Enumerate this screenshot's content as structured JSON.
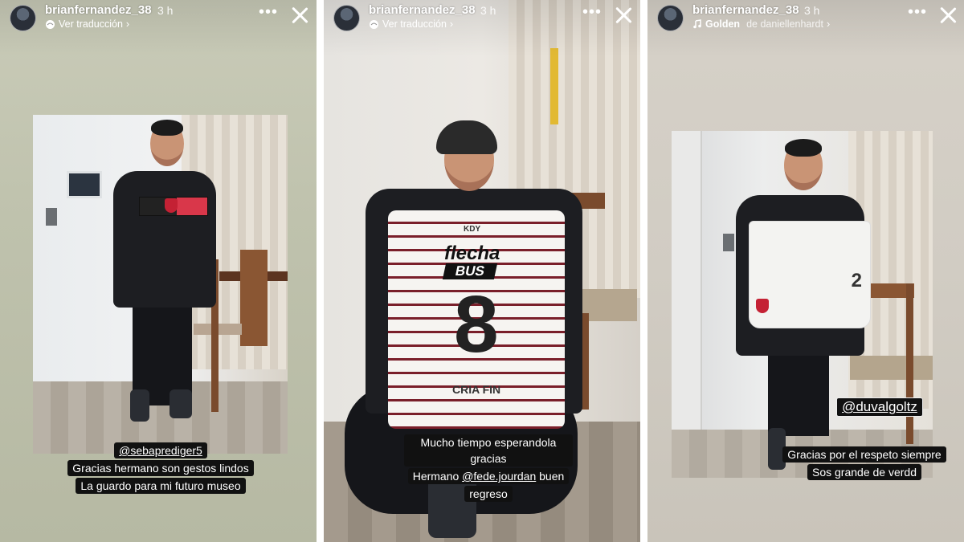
{
  "stories": [
    {
      "username": "brianfernandez_38",
      "time": "3 h",
      "subline": "Ver traducción",
      "more_label": "•••",
      "captions": {
        "mention": "@sebaprediger5",
        "line1": "Gracias hermano son gestos lindos",
        "line2": "La guardo para mi futuro museo"
      }
    },
    {
      "username": "brianfernandez_38",
      "time": "3 h",
      "subline": "Ver traducción",
      "more_label": "•••",
      "captions": {
        "line1": "Mucho tiempo esperandola gracias",
        "line2_prefix": "Hermano",
        "line2_mention": "@fede.jourdan",
        "line2_suffix": "buen",
        "line3": "regreso"
      },
      "jersey": {
        "sponsor_top": "flecha",
        "sponsor_bottom": "BUS",
        "number": "8",
        "brand": "KDY",
        "lower_sponsor": "CRIA",
        "lower_sponsor2": "FIN"
      }
    },
    {
      "username": "brianfernandez_38",
      "time": "3 h",
      "music_title": "Golden",
      "music_artist": "de daniellenhardt",
      "more_label": "•••",
      "captions": {
        "mention": "@duvalgoltz",
        "line1": "Gracias por el respeto siempre",
        "line2": "Sos grande de verdd"
      },
      "shorts_number": "2"
    }
  ],
  "colors": {
    "sticker_bg": "#111111",
    "text_white": "#ffffff",
    "jersey_stripe": "#7a1f2a",
    "armband_red": "#d9374a"
  },
  "icons": [
    "chevron-right-icon",
    "translate-icon",
    "music-icon",
    "close-icon",
    "more-icon"
  ]
}
